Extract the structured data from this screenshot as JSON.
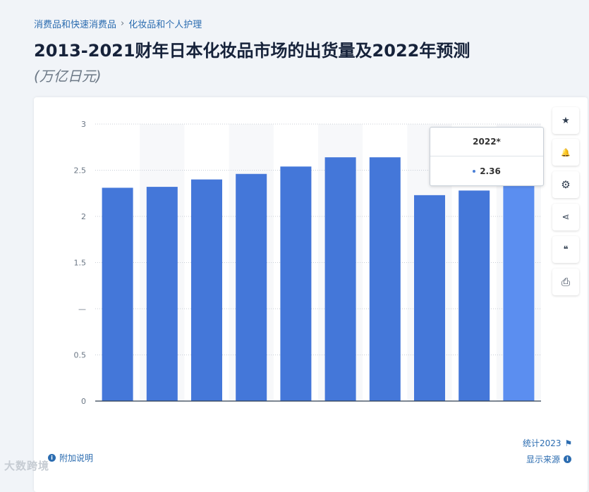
{
  "breadcrumb": {
    "item1": "消费品和快速消费品",
    "separator": "›",
    "item2": "化妆品和个人护理"
  },
  "title": "2013-2021财年日本化妆品市场的出货量及2022年预测",
  "subtitle": "(万亿日元)",
  "tooltip": {
    "label": "2022*",
    "value": "2.36"
  },
  "side_toolbar": [
    {
      "name": "star-icon",
      "glyph": "★"
    },
    {
      "name": "bell-icon",
      "glyph": "🔔"
    },
    {
      "name": "gear-icon",
      "glyph": "⚙"
    },
    {
      "name": "share-icon",
      "glyph": "⋖"
    },
    {
      "name": "quote-icon",
      "glyph": "❝"
    },
    {
      "name": "print-icon",
      "glyph": "⎙"
    }
  ],
  "footer": {
    "additional_info": "附加说明",
    "statista": "统计2023",
    "show_source": "显示来源"
  },
  "watermark": "大数跨境",
  "colors": {
    "bar": "#4477d9",
    "bar_highlight": "#5b8ef0",
    "band": "#f7f8fa"
  },
  "chart_data": {
    "type": "bar",
    "title": "2013-2021财年日本化妆品市场的出货量及2022年预测",
    "subtitle": "(万亿日元)",
    "categories": [
      "",
      "",
      "",
      "",
      "",
      "",
      "",
      "",
      "",
      "2022*"
    ],
    "values": [
      2.31,
      2.32,
      2.4,
      2.46,
      2.54,
      2.64,
      2.64,
      2.23,
      2.28,
      2.36
    ],
    "ylim": [
      0,
      3
    ],
    "yticks": [
      "0",
      "0.5",
      "—",
      "1.5",
      "2",
      "2.5",
      "3"
    ],
    "grid": true,
    "highlight_index": 9
  }
}
